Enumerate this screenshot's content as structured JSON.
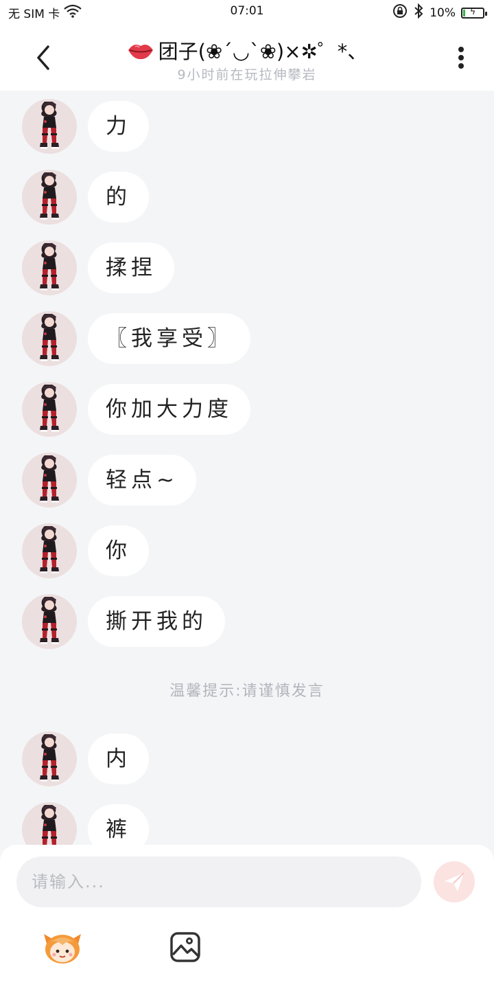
{
  "status_bar": {
    "carrier": "无 SIM 卡",
    "time": "07:01",
    "battery_percent_text": "10%",
    "battery_level": 0.1
  },
  "header": {
    "title": "团子(❀´◡`❀)×✲゜*、",
    "subtitle": "9小时前在玩拉伸攀岩"
  },
  "messages": [
    {
      "text": "力"
    },
    {
      "text": "的"
    },
    {
      "text": "揉捏"
    },
    {
      "text": "〖我享受〗"
    },
    {
      "text": "你加大力度"
    },
    {
      "text": "轻点~"
    },
    {
      "text": "你"
    },
    {
      "text": "撕开我的"
    },
    {
      "text": "内"
    },
    {
      "text": "裤"
    }
  ],
  "hint": "温馨提示:请谨慎发言",
  "composer": {
    "placeholder": "请输入..."
  },
  "colors": {
    "background": "#f4f5f7",
    "bubble": "#ffffff",
    "send_button": "#fbe3e2",
    "avatar_bg": "#ecdfe0"
  },
  "icons": [
    "back-icon",
    "more-icon",
    "lips-icon",
    "send-icon",
    "emoji-mascot-icon",
    "image-icon",
    "wifi-icon",
    "bluetooth-icon",
    "rotation-lock-icon",
    "battery-icon"
  ]
}
